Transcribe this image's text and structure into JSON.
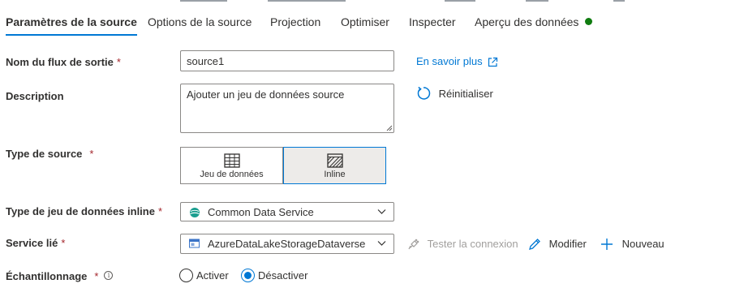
{
  "tabs": [
    {
      "label": "Paramètres de la source",
      "active": true
    },
    {
      "label": "Options de la source"
    },
    {
      "label": "Projection"
    },
    {
      "label": "Optimiser"
    },
    {
      "label": "Inspecter"
    },
    {
      "label": "Aperçu des données"
    }
  ],
  "status_color": "#107c10",
  "accent_color": "#0078d4",
  "required_marker": "*",
  "output_stream": {
    "label": "Nom du flux de sortie",
    "value": "source1"
  },
  "learn_more": {
    "label": "En savoir plus",
    "icon": "external-link-icon"
  },
  "description": {
    "label": "Description",
    "value": "Ajouter un jeu de données source"
  },
  "reset": {
    "label": "Réinitialiser",
    "icon": "reset-icon"
  },
  "source_type": {
    "label": "Type de source",
    "options": [
      {
        "label": "Jeu de données",
        "icon": "table-icon",
        "selected": false
      },
      {
        "label": "Inline",
        "icon": "inline-hatch-icon",
        "selected": true
      }
    ]
  },
  "inline_dataset_type": {
    "label": "Type de jeu de données inline",
    "value": "Common Data Service",
    "icon": "common-data-service-icon"
  },
  "linked_service": {
    "label": "Service lié",
    "value": "AzureDataLakeStorageDataverse",
    "icon": "storage-icon"
  },
  "linked_actions": {
    "test_connection": "Tester la connexion",
    "edit": "Modifier",
    "new": "Nouveau"
  },
  "sampling": {
    "label": "Échantillonnage",
    "info_icon": "info-icon",
    "options": [
      {
        "label": "Activer",
        "checked": false
      },
      {
        "label": "Désactiver",
        "checked": true
      }
    ]
  }
}
